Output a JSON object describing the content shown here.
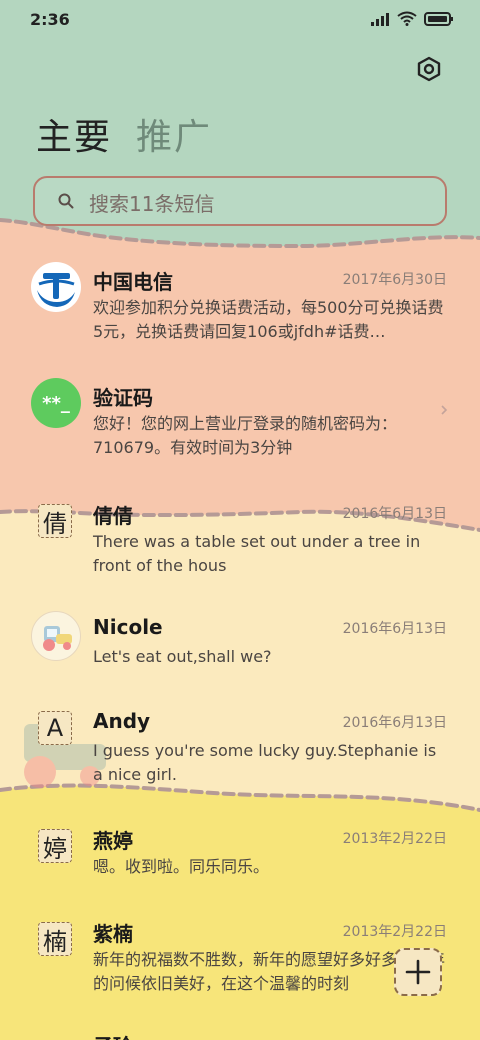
{
  "status_bar": {
    "time": "2:36"
  },
  "tabs": [
    {
      "label": "主要",
      "active": true
    },
    {
      "label": "推广",
      "active": false
    }
  ],
  "search": {
    "placeholder": "搜索11条短信"
  },
  "messages": [
    {
      "sender": "中国电信",
      "date": "2017年6月30日",
      "preview": "欢迎参加积分兑换话费活动，每500分可兑换话费5元，兑换话费请回复106或jfdh#话费…",
      "avatar": "china-telecom-logo"
    },
    {
      "sender": "验证码",
      "date": "",
      "preview": "您好！您的网上营业厅登录的随机密码为：710679。有效时间为3分钟",
      "avatar_text": "**_"
    },
    {
      "sender": "倩倩",
      "date": "2016年6月13日",
      "preview": "There was a table set out under a tree in front of the hous",
      "avatar_text": "倩"
    },
    {
      "sender": "Nicole",
      "date": "2016年6月13日",
      "preview": "Let's eat out,shall we?",
      "avatar": "toy-tractor-icon"
    },
    {
      "sender": "Andy",
      "date": "2016年6月13日",
      "preview": "I guess you're some lucky guy.Stephanie is a nice girl.",
      "avatar_text": "A"
    },
    {
      "sender": "燕婷",
      "date": "2013年2月22日",
      "preview": "嗯。收到啦。同乐同乐。",
      "avatar_text": "婷"
    },
    {
      "sender": "紫楠",
      "date": "2013年2月22日",
      "preview": "新年的祝福数不胜数，新年的愿望好多好多，新年的问候依旧美好，在这个温馨的时刻",
      "avatar_text": "楠"
    },
    {
      "sender": "子玲",
      "date": "",
      "preview": "",
      "avatar_text": ""
    }
  ],
  "colors": {
    "header_bg": "#b4d6bf",
    "band_orange": "#f7c7ad",
    "band_cream": "#fbeabe",
    "band_yellow": "#f7e57a",
    "dash": "#b59a96"
  }
}
